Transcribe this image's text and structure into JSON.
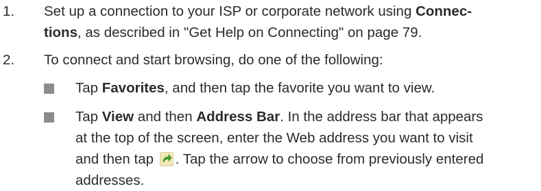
{
  "steps": [
    {
      "number": "1.",
      "line1_prefix": "Set up a connection to your ISP or corporate network using ",
      "line1_bold": "Connec-",
      "line2_bold": "tions",
      "line2_suffix": ", as described in \"Get Help on Connecting\" on page 79."
    },
    {
      "number": "2.",
      "text": "To connect and start browsing, do one of the following:",
      "bullets": [
        {
          "prefix": "Tap ",
          "bold": "Favorites",
          "suffix": ", and then tap the favorite you want to view."
        },
        {
          "prefix": "Tap ",
          "bold1": "View",
          "middle": " and then ",
          "bold2": "Address Bar",
          "line1_suffix": ". In the address bar that appears",
          "line2": "at the top of the screen, enter the Web address you want to visit",
          "line3_prefix": "and then tap ",
          "icon": "go-arrow-icon",
          "line3_suffix": ". Tap the arrow to choose from previously entered",
          "line4": "addresses."
        }
      ]
    }
  ],
  "colors": {
    "text": "#2b2b2b",
    "bullet": "#8c8c8c",
    "icon_arrow": "#3da02c",
    "icon_bg": "#f2e9b8"
  }
}
